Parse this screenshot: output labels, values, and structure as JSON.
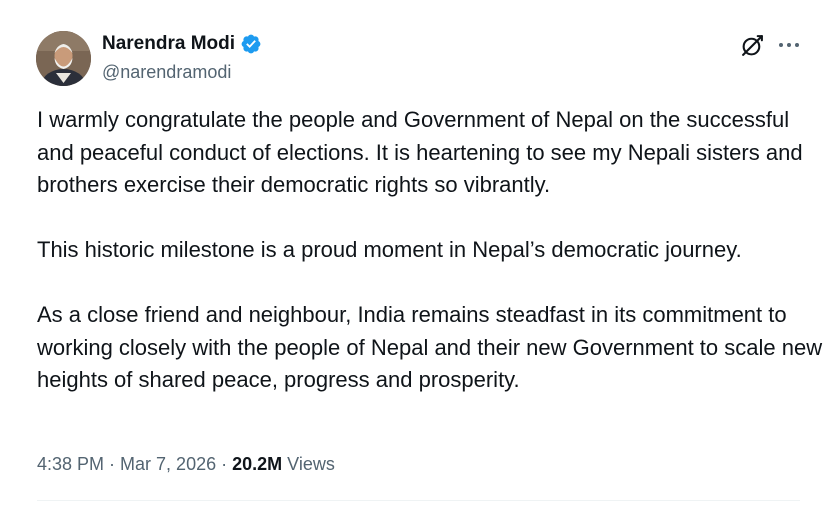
{
  "author": {
    "display_name": "Narendra Modi",
    "handle": "@narendramodi",
    "verified": true,
    "verified_color": "#1d9bf0",
    "verified_icon": "verified-badge-icon",
    "avatar_icon": "profile-photo"
  },
  "actions": {
    "grok_icon": "grok-icon",
    "more_icon": "more-options-icon"
  },
  "tweet": {
    "paragraphs": [
      "I warmly congratulate the people and Government of Nepal on the successful and peaceful conduct of elections. It is heartening to see my Nepali sisters and brothers exercise their democratic rights so vibrantly.",
      "This historic milestone is a proud moment in Nepal’s democratic journey.",
      "As a close friend and neighbour, India remains steadfast in its commitment to working closely with the people of Nepal and their new Government to scale new heights of shared peace, progress and prosperity."
    ]
  },
  "meta": {
    "time": "4:38 PM",
    "separator": " · ",
    "date": "Mar 7, 2026",
    "views_count": "20.2M",
    "views_label": " Views"
  },
  "colors": {
    "text": "#0f1419",
    "secondary_text": "#536471",
    "divider": "#eff3f4"
  }
}
